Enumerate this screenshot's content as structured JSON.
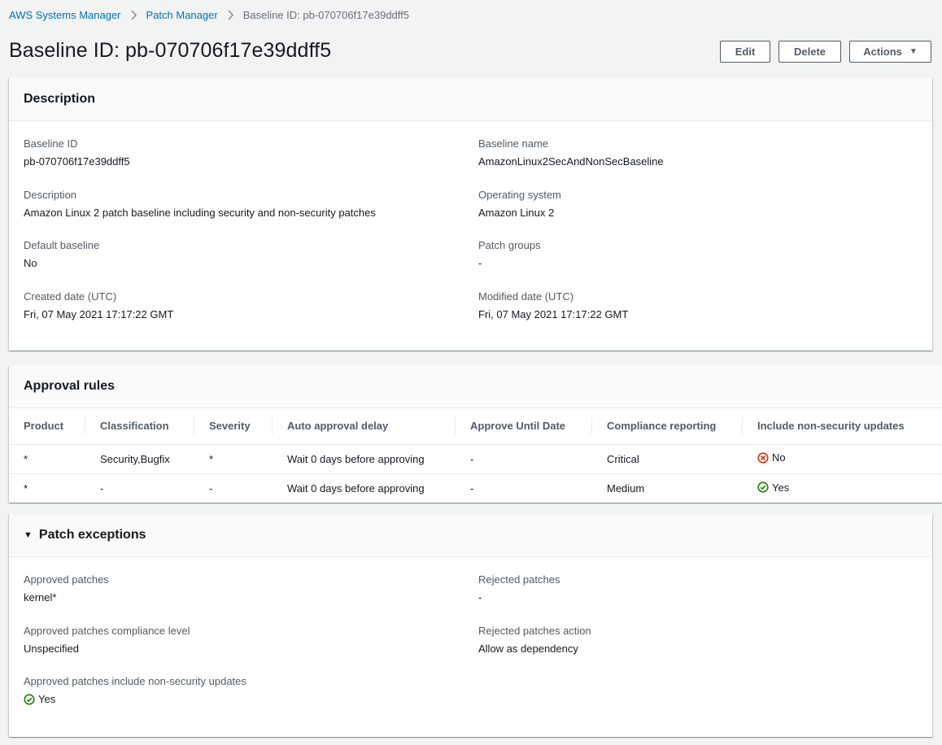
{
  "breadcrumb": {
    "items": [
      "AWS Systems Manager",
      "Patch Manager"
    ],
    "current": "Baseline ID: pb-070706f17e39ddff5"
  },
  "page": {
    "title": "Baseline ID: pb-070706f17e39ddff5"
  },
  "actions": {
    "edit": "Edit",
    "delete": "Delete",
    "actions": "Actions"
  },
  "description": {
    "heading": "Description",
    "baseline_id": {
      "label": "Baseline ID",
      "value": "pb-070706f17e39ddff5"
    },
    "baseline_name": {
      "label": "Baseline name",
      "value": "AmazonLinux2SecAndNonSecBaseline"
    },
    "description": {
      "label": "Description",
      "value": "Amazon Linux 2 patch baseline including security and non-security patches"
    },
    "os": {
      "label": "Operating system",
      "value": "Amazon Linux 2"
    },
    "default_baseline": {
      "label": "Default baseline",
      "value": "No"
    },
    "patch_groups": {
      "label": "Patch groups",
      "value": "-"
    },
    "created": {
      "label": "Created date (UTC)",
      "value": "Fri, 07 May 2021 17:17:22 GMT"
    },
    "modified": {
      "label": "Modified date (UTC)",
      "value": "Fri, 07 May 2021 17:17:22 GMT"
    }
  },
  "approval": {
    "heading": "Approval rules",
    "columns": [
      "Product",
      "Classification",
      "Severity",
      "Auto approval delay",
      "Approve Until Date",
      "Compliance reporting",
      "Include non-security updates"
    ],
    "rows": [
      {
        "product": "*",
        "classification": "Security,Bugfix",
        "severity": "*",
        "delay": "Wait 0 days before approving",
        "until": "-",
        "compliance": "Critical",
        "nonsec": "No"
      },
      {
        "product": "*",
        "classification": "-",
        "severity": "-",
        "delay": "Wait 0 days before approving",
        "until": "-",
        "compliance": "Medium",
        "nonsec": "Yes"
      }
    ]
  },
  "exceptions": {
    "heading": "Patch exceptions",
    "approved": {
      "label": "Approved patches",
      "value": "kernel*"
    },
    "rejected": {
      "label": "Rejected patches",
      "value": "-"
    },
    "approved_level": {
      "label": "Approved patches compliance level",
      "value": "Unspecified"
    },
    "rejected_action": {
      "label": "Rejected patches action",
      "value": "Allow as dependency"
    },
    "approved_nonsec": {
      "label": "Approved patches include non-security updates",
      "value": "Yes"
    }
  },
  "colors": {
    "link": "#0073bb",
    "success": "#1d8102",
    "error": "#d13212"
  }
}
